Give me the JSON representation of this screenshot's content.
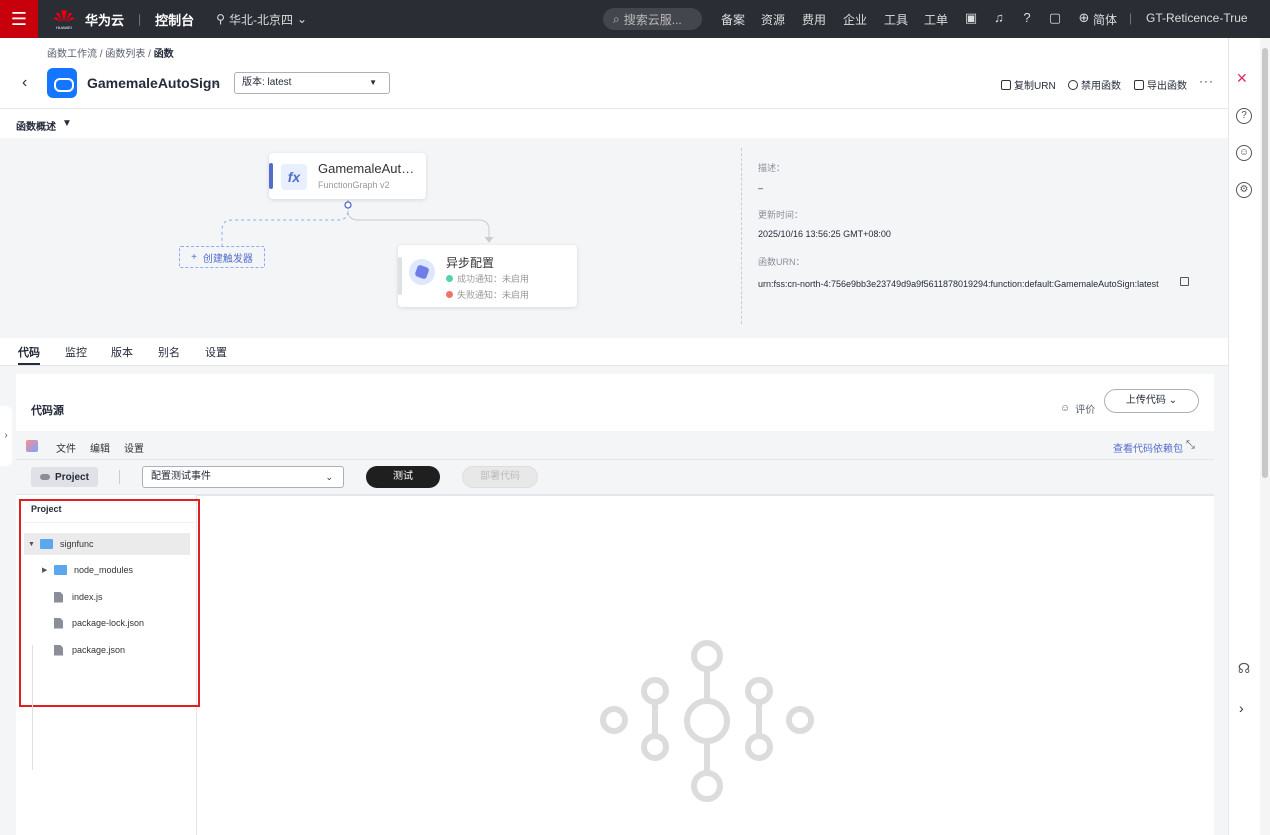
{
  "topbar": {
    "brand_small": "HUAWEI",
    "brand": "华为云",
    "console": "控制台",
    "region": "华北-北京四",
    "search_placeholder": "搜索云服...",
    "nav": [
      "备案",
      "资源",
      "费用",
      "企业",
      "工具",
      "工单"
    ],
    "lang": "简体",
    "user": "GT-Reticence-True"
  },
  "breadcrumb": {
    "items": [
      "函数工作流",
      "函数列表"
    ],
    "current": "函数"
  },
  "header": {
    "function_name": "GamemaleAutoSign",
    "version_label": "版本: latest",
    "actions": {
      "copy_urn": "复制URN",
      "disable": "禁用函数",
      "export": "导出函数"
    }
  },
  "overview": {
    "label": "函数概述",
    "fn_card": {
      "title": "GamemaleAutoSign",
      "subtitle": "FunctionGraph v2"
    },
    "trigger_button": "创建触发器",
    "async_card": {
      "title": "异步配置",
      "success": "成功通知：未启用",
      "failure": "失败通知：未启用"
    },
    "info": {
      "desc_label": "描述：",
      "desc_value": "–",
      "updated_label": "更新时间：",
      "updated_value": "2025/10/16 13:56:25 GMT+08:00",
      "urn_label": "函数URN：",
      "urn_value": "urn:fss:cn-north-4:756e9bb3e23749d9a9f5611878019294:function:default:GamemaleAutoSign:latest"
    }
  },
  "tabs": [
    "代码",
    "监控",
    "版本",
    "别名",
    "设置"
  ],
  "code": {
    "title": "代码源",
    "rate": "评价",
    "upload": "上传代码",
    "menu": [
      "文件",
      "编辑",
      "设置"
    ],
    "view_deps": "查看代码依赖包",
    "project_button": "Project",
    "event_select": "配置测试事件",
    "test": "测试",
    "deploy": "部署代码"
  },
  "explorer": {
    "title": "Project",
    "root": "signfunc",
    "items": [
      "node_modules",
      "index.js",
      "package-lock.json",
      "package.json"
    ]
  },
  "colors": {
    "brand_red": "#c7000b",
    "topbar_bg": "#2b2d35",
    "accent": "#526ecc",
    "highlight_box": "#e02020"
  }
}
